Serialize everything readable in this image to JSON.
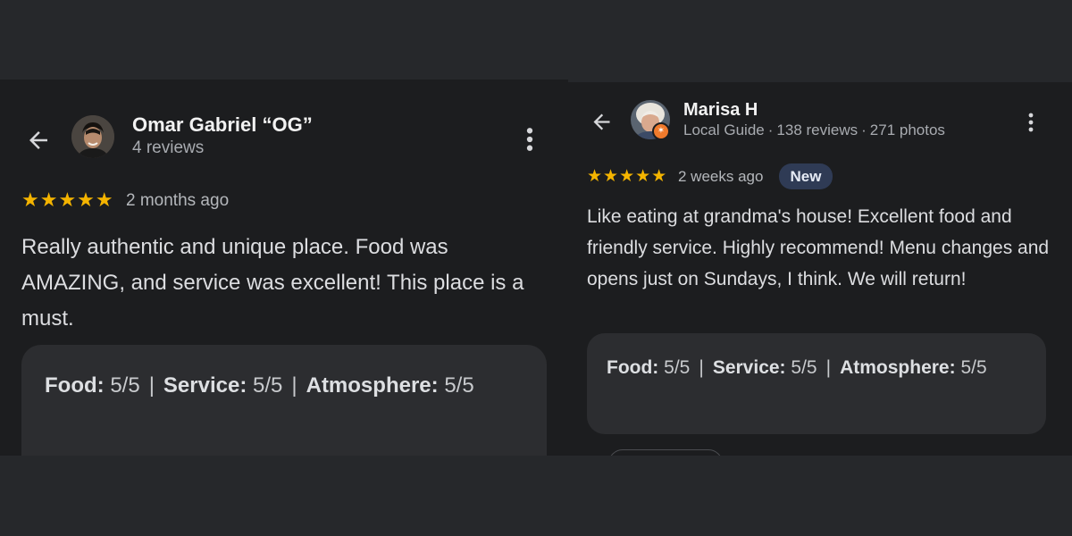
{
  "reviews": [
    {
      "reviewer_name": "Omar Gabriel “OG”",
      "reviewer_meta": "4 reviews",
      "stars": "★★★★★",
      "rating": 5,
      "date": "2 months ago",
      "text": "Really authentic and unique place. Food was AMAZING, and service was excellent! This place is a must.",
      "ratings": {
        "food_label": "Food:",
        "food_value": "5/5",
        "service_label": "Service:",
        "service_value": "5/5",
        "atmosphere_label": "Atmosphere:",
        "atmosphere_value": "5/5",
        "separator": "|"
      },
      "icons": {
        "back": "arrow-back-icon",
        "more": "more-vert-icon"
      }
    },
    {
      "reviewer_name": "Marisa H",
      "reviewer_role": "Local Guide",
      "reviewer_reviews": "138 reviews",
      "reviewer_photos": "271 photos",
      "meta_dot": "·",
      "stars": "★★★★★",
      "rating": 5,
      "date": "2 weeks ago",
      "badge": "New",
      "text": "Like eating at grandma's house! Excellent food and friendly service. Highly recommend! Menu changes and opens just on Sundays, I think. We will return!",
      "ratings": {
        "food_label": "Food:",
        "food_value": "5/5",
        "service_label": "Service:",
        "service_value": "5/5",
        "atmosphere_label": "Atmosphere:",
        "atmosphere_value": "5/5",
        "separator": "|"
      },
      "icons": {
        "back": "arrow-back-icon",
        "more": "more-vert-icon",
        "guide": "local-guide-star-icon"
      }
    }
  ],
  "colors": {
    "page_bg": "#26282b",
    "panel_bg": "#1c1d1f",
    "card_bg": "#2c2d30",
    "star": "#f4b400",
    "badge_bg": "#2f3b55",
    "guide_badge": "#f07a2c"
  }
}
